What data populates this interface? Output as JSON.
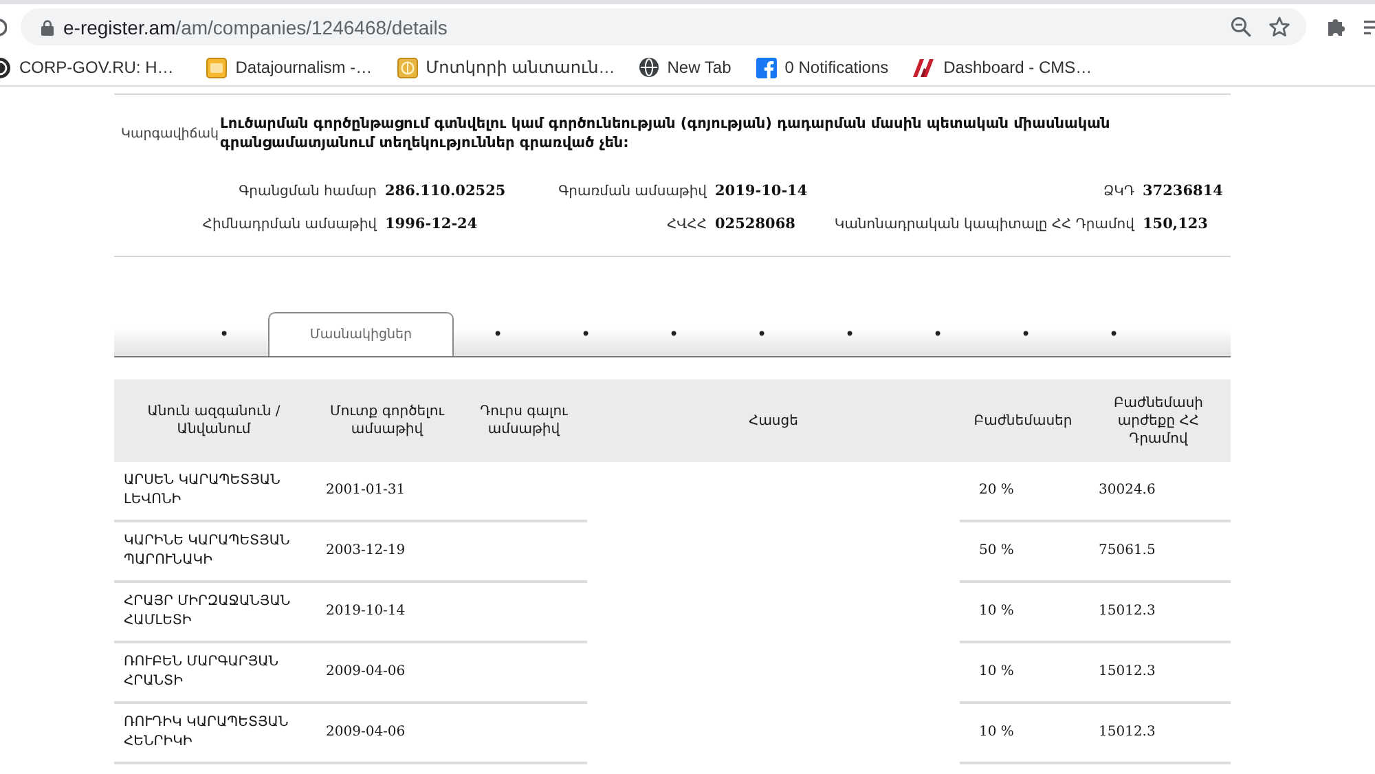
{
  "browser": {
    "url": {
      "host": "e-register.am",
      "path": "/am/companies/1246468/details"
    }
  },
  "bookmarks": [
    {
      "kind": "disc",
      "label": "CORP-GOV.RU: H…"
    },
    {
      "kind": "tile",
      "label": "Datajournalism -…"
    },
    {
      "kind": "emblem",
      "label": "Մոտկորի անտաուն…"
    },
    {
      "kind": "globe",
      "label": "New Tab"
    },
    {
      "kind": "square",
      "label": "0 Notifications"
    },
    {
      "kind": "logo",
      "label": "Dashboard - CMS…"
    }
  ],
  "status": {
    "label": "Կարգավիճակ",
    "text": "Լուծարման գործընթացում գտնվելու կամ գործունեության (գոյության) դադարման մասին պետական միասնական գրանցամատյանում տեղեկություններ գրառված չեն:"
  },
  "fields": [
    {
      "label": "Գրանցման համար",
      "value": "286.110.02525"
    },
    {
      "label": "Գրառման ամսաթիվ",
      "value": "2019-10-14"
    },
    {
      "label": "ՁԿԴ",
      "value": "37236814"
    },
    {
      "label": "Հիմնադրման ամսաթիվ",
      "value": "1996-12-24"
    },
    {
      "label": "ՀՎՀՀ",
      "value": "02528068"
    },
    {
      "label": "Կանոնադրական կապիտալը ՀՀ Դրամով",
      "value": "150,123"
    }
  ],
  "tabs": [
    {
      "label": "•",
      "selected": false
    },
    {
      "label": "Մասնակիցներ",
      "selected": true
    },
    {
      "label": "•",
      "selected": false
    },
    {
      "label": "•",
      "selected": false
    },
    {
      "label": "•",
      "selected": false
    },
    {
      "label": "•",
      "selected": false
    },
    {
      "label": "•",
      "selected": false
    },
    {
      "label": "•",
      "selected": false
    },
    {
      "label": "•",
      "selected": false
    },
    {
      "label": "•",
      "selected": false
    }
  ],
  "table": {
    "columns": [
      "Անուն ազգանուն / Անվանում",
      "Մուտք գործելու ամսաթիվ",
      "Դուրս գալու ամսաթիվ",
      "Հասցե",
      "Բաժնեմասեր",
      "Բաժնեմասի արժեքը ՀՀ Դրամով"
    ],
    "rows": [
      {
        "name": "ԱՐՍԵՆ ԿԱՐԱՊԵՏՅԱՆ ԼԵՎՈՆԻ",
        "entry_date": "2001-01-31",
        "share": "20 %",
        "share_value": "30024.6"
      },
      {
        "name": "ԿԱՐԻՆԵ ԿԱՐԱՊԵՏՅԱՆ ՊԱՐՈՒՆԱԿԻ",
        "entry_date": "2003-12-19",
        "share": "50 %",
        "share_value": "75061.5"
      },
      {
        "name": "ՀՐԱՅՐ ՄԻՐԶԱՋԱՆՅԱՆ ՀԱՄԼԵՏԻ",
        "entry_date": "2019-10-14",
        "share": "10 %",
        "share_value": "15012.3"
      },
      {
        "name": "ՌՈՒԲԵՆ ՄԱՐԳԱՐՅԱՆ ՀՐԱՆՏԻ",
        "entry_date": "2009-04-06",
        "share": "10 %",
        "share_value": "15012.3"
      },
      {
        "name": "ՌՈՒԴԻԿ ԿԱՐԱՊԵՏՅԱՆ ՀԵՆՐԻԿԻ",
        "entry_date": "2009-04-06",
        "share": "10 %",
        "share_value": "15012.3"
      }
    ]
  }
}
